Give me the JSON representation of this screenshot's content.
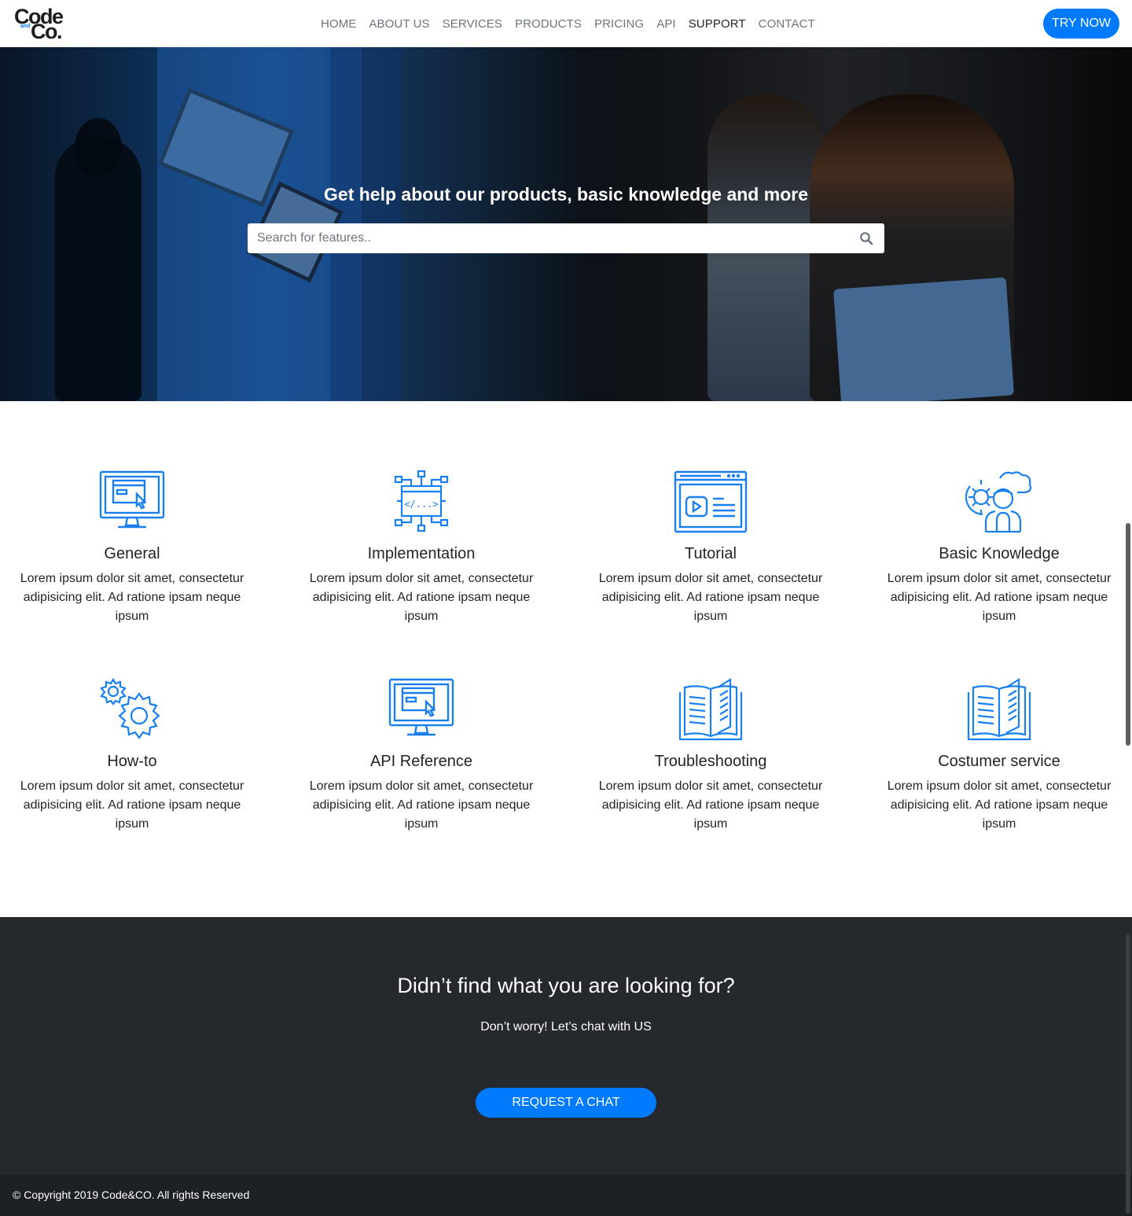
{
  "brand": {
    "logo_top": "Code",
    "logo_bottom": "Co.",
    "logo_mid": "and"
  },
  "nav": {
    "items": [
      {
        "label": "HOME",
        "active": false
      },
      {
        "label": "ABOUT US",
        "active": false
      },
      {
        "label": "SERVICES",
        "active": false
      },
      {
        "label": "PRODUCTS",
        "active": false
      },
      {
        "label": "PRICING",
        "active": false
      },
      {
        "label": "API",
        "active": false
      },
      {
        "label": "SUPPORT",
        "active": true
      },
      {
        "label": "CONTACT",
        "active": false
      }
    ],
    "cta_label": "TRY NOW"
  },
  "hero": {
    "title": "Get help about our products, basic knowledge and more",
    "search_placeholder": "Search for features.."
  },
  "features": [
    {
      "title": "General",
      "text": "Lorem ipsum dolor sit amet, consectetur adipisicing elit. Ad ratione ipsam neque ipsum",
      "icon": "monitor-cursor-icon"
    },
    {
      "title": "Implementation",
      "text": "Lorem ipsum dolor sit amet, consectetur adipisicing elit. Ad ratione ipsam neque ipsum",
      "icon": "code-circuit-icon"
    },
    {
      "title": "Tutorial",
      "text": "Lorem ipsum dolor sit amet, consectetur adipisicing elit. Ad ratione ipsam neque ipsum",
      "icon": "video-browser-icon"
    },
    {
      "title": "Basic Knowledge",
      "text": "Lorem ipsum dolor sit amet, consectetur adipisicing elit. Ad ratione ipsam neque ipsum",
      "icon": "person-gear-cloud-icon"
    },
    {
      "title": "How-to",
      "text": "Lorem ipsum dolor sit amet, consectetur adipisicing elit. Ad ratione ipsam neque ipsum",
      "icon": "gears-icon"
    },
    {
      "title": "API Reference",
      "text": "Lorem ipsum dolor sit amet, consectetur adipisicing elit. Ad ratione ipsam neque ipsum",
      "icon": "monitor-cursor-icon"
    },
    {
      "title": "Troubleshooting",
      "text": "Lorem ipsum dolor sit amet, consectetur adipisicing elit. Ad ratione ipsam neque ipsum",
      "icon": "open-book-icon"
    },
    {
      "title": "Costumer service",
      "text": "Lorem ipsum dolor sit amet, consectetur adipisicing elit. Ad ratione ipsam neque ipsum",
      "icon": "open-book-icon"
    }
  ],
  "cta": {
    "title": "Didn’t find what you are looking for?",
    "subtitle": "Don’t worry! Let’s chat with US",
    "button_label": "REQUEST A CHAT"
  },
  "footer": {
    "copyright": "© Copyright 2019 Code&CO. All rights Reserved"
  },
  "colors": {
    "accent": "#007bff",
    "dark": "#25282c",
    "footer": "#1d2024"
  }
}
